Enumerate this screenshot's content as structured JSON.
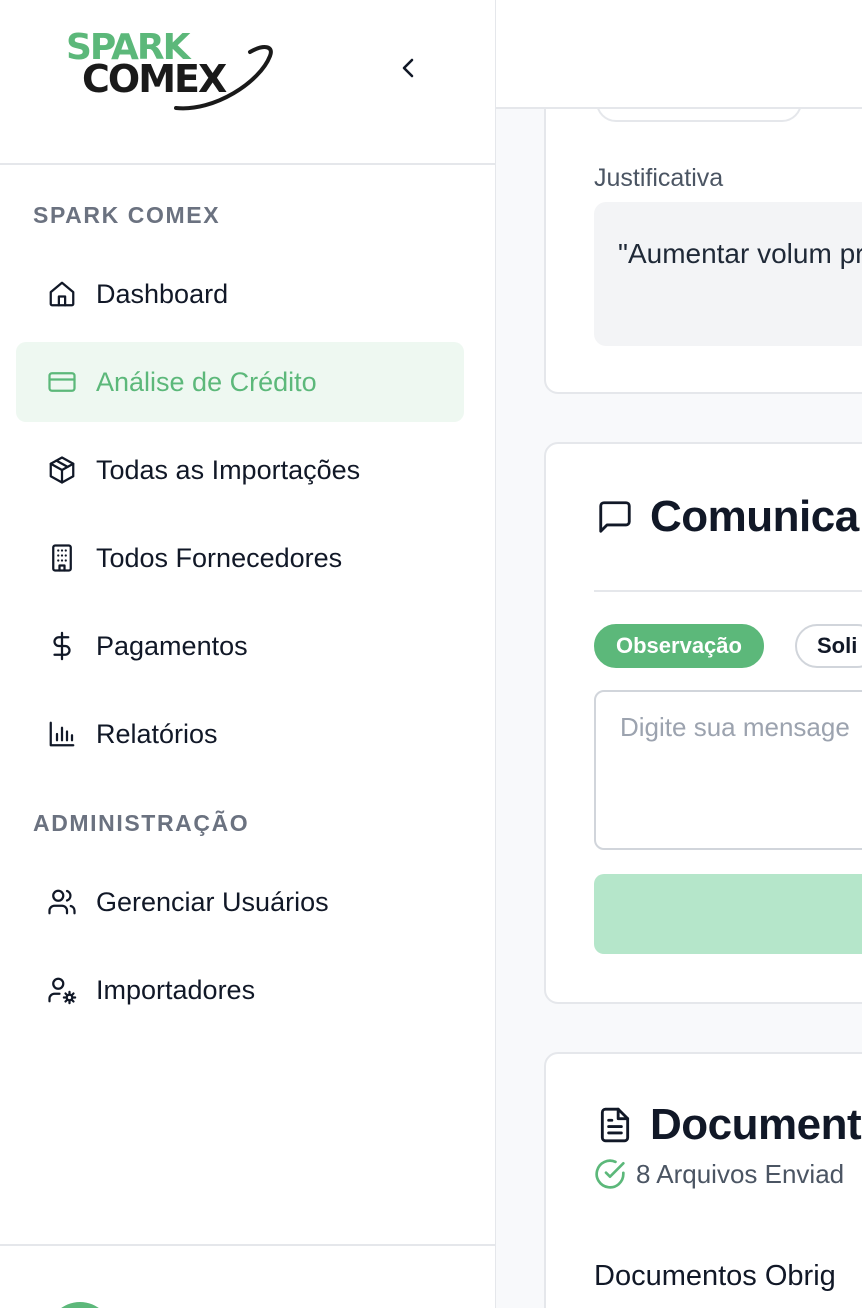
{
  "brand": {
    "logo_line1": "SPARK",
    "logo_line2": "COMEX",
    "accent_color": "#5cb87a"
  },
  "sidebar": {
    "collapse_icon": "chevron-left-icon",
    "sections": [
      {
        "label": "SPARK COMEX",
        "items": [
          {
            "label": "Dashboard",
            "icon": "home-icon",
            "active": false
          },
          {
            "label": "Análise de Crédito",
            "icon": "credit-card-icon",
            "active": true
          },
          {
            "label": "Todas as Importações",
            "icon": "package-icon",
            "active": false
          },
          {
            "label": "Todos Fornecedores",
            "icon": "building-icon",
            "active": false
          },
          {
            "label": "Pagamentos",
            "icon": "dollar-sign-icon",
            "active": false
          },
          {
            "label": "Relatórios",
            "icon": "bar-chart-icon",
            "active": false
          }
        ]
      },
      {
        "label": "ADMINISTRAÇÃO",
        "items": [
          {
            "label": "Gerenciar Usuários",
            "icon": "users-icon",
            "active": false
          },
          {
            "label": "Importadores",
            "icon": "user-cog-icon",
            "active": false
          }
        ]
      }
    ]
  },
  "main": {
    "justification": {
      "label": "Justificativa",
      "text": "\"Aumentar volum preços\""
    },
    "communication": {
      "title": "Comunica",
      "icon": "message-square-icon",
      "chips": [
        "Observação",
        "Soli"
      ],
      "active_chip": "Observação",
      "input_placeholder": "Digite sua mensage"
    },
    "documents": {
      "title": "Document",
      "icon": "file-text-icon",
      "status_icon": "check-circle-icon",
      "status_text": "8 Arquivos Enviad",
      "subheading": "Documentos Obrig"
    }
  }
}
